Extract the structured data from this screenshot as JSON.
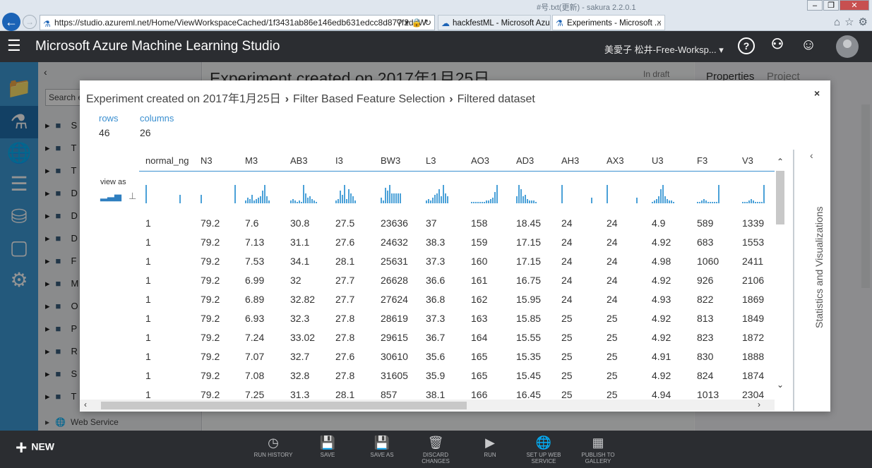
{
  "browser": {
    "url": "https://studio.azureml.net/Home/ViewWorkspaceCached/1f3431ab86e146edb631edcc8d877f2d#W",
    "ghost_title": "#号.txt(更新) - sakura 2.2.0.1",
    "tabs": [
      {
        "label": "hackfestML - Microsoft Azure"
      },
      {
        "label": "Experiments - Microsoft ..."
      }
    ],
    "tab_close": "×"
  },
  "header": {
    "app_title": "Microsoft Azure Machine Learning Studio",
    "workspace": "美愛子 松井-Free-Worksp...",
    "help_icon": "?",
    "community_icon": "⚇",
    "feedback_icon": "☺"
  },
  "sidebar_modules": {
    "search_placeholder": "Search e",
    "items": [
      "S",
      "T",
      "T",
      "D",
      "D",
      "D",
      "F",
      "M",
      "O",
      "P",
      "R",
      "S",
      "T"
    ],
    "footer": "Web Service"
  },
  "canvas": {
    "title": "Experiment created on 2017年1月25日",
    "status": "In draft"
  },
  "properties": {
    "tab1": "Properties",
    "tab2": "Project"
  },
  "modal": {
    "breadcrumb": [
      "Experiment created on 2017年1月25日",
      "Filter Based Feature Selection",
      "Filtered dataset"
    ],
    "rows_label": "rows",
    "rows_value": "46",
    "columns_label": "columns",
    "columns_value": "26",
    "view_as": "view as",
    "side_label": "Statistics and Visualizations",
    "close": "×"
  },
  "table": {
    "columns": [
      "normal_ng",
      "N3",
      "M3",
      "AB3",
      "I3",
      "BW3",
      "L3",
      "AO3",
      "AD3",
      "AH3",
      "AX3",
      "U3",
      "F3",
      "V3"
    ],
    "rows": [
      [
        "1",
        "79.2",
        "7.6",
        "30.8",
        "27.5",
        "23636",
        "37",
        "158",
        "18.45",
        "24",
        "24",
        "4.9",
        "589",
        "1339"
      ],
      [
        "1",
        "79.2",
        "7.13",
        "31.1",
        "27.6",
        "24632",
        "38.3",
        "159",
        "17.15",
        "24",
        "24",
        "4.92",
        "683",
        "1553"
      ],
      [
        "1",
        "79.2",
        "7.53",
        "34.1",
        "28.1",
        "25631",
        "37.3",
        "160",
        "17.15",
        "24",
        "24",
        "4.98",
        "1060",
        "2411"
      ],
      [
        "1",
        "79.2",
        "6.99",
        "32",
        "27.7",
        "26628",
        "36.6",
        "161",
        "16.75",
        "24",
        "24",
        "4.92",
        "926",
        "2106"
      ],
      [
        "1",
        "79.2",
        "6.89",
        "32.82",
        "27.7",
        "27624",
        "36.8",
        "162",
        "15.95",
        "24",
        "24",
        "4.93",
        "822",
        "1869"
      ],
      [
        "1",
        "79.2",
        "6.93",
        "32.3",
        "27.8",
        "28619",
        "37.3",
        "163",
        "15.85",
        "25",
        "25",
        "4.92",
        "813",
        "1849"
      ],
      [
        "1",
        "79.2",
        "7.24",
        "33.02",
        "27.8",
        "29615",
        "36.7",
        "164",
        "15.55",
        "25",
        "25",
        "4.92",
        "823",
        "1872"
      ],
      [
        "1",
        "79.2",
        "7.07",
        "32.7",
        "27.6",
        "30610",
        "35.6",
        "165",
        "15.35",
        "25",
        "25",
        "4.91",
        "830",
        "1888"
      ],
      [
        "1",
        "79.2",
        "7.08",
        "32.8",
        "27.8",
        "31605",
        "35.9",
        "165",
        "15.45",
        "25",
        "25",
        "4.92",
        "824",
        "1874"
      ],
      [
        "1",
        "79.2",
        "7.25",
        "31.3",
        "28.1",
        "857",
        "38.1",
        "166",
        "16.45",
        "25",
        "25",
        "4.94",
        "1013",
        "2304"
      ]
    ]
  },
  "toolbar": {
    "new_label": "NEW",
    "buttons": [
      {
        "label": "RUN HISTORY",
        "icon": "history-icon"
      },
      {
        "label": "SAVE",
        "icon": "save-icon"
      },
      {
        "label": "SAVE AS",
        "icon": "save-as-icon"
      },
      {
        "label": "DISCARD CHANGES",
        "icon": "trash-icon"
      },
      {
        "label": "RUN",
        "icon": "play-icon"
      },
      {
        "label": "SET UP WEB SERVICE",
        "icon": "web-service-icon"
      },
      {
        "label": "PUBLISH TO GALLERY",
        "icon": "gallery-icon"
      }
    ]
  },
  "colors": {
    "accent": "#3a8fd0",
    "rail": "#3d99d6",
    "header": "#2b2d31"
  }
}
